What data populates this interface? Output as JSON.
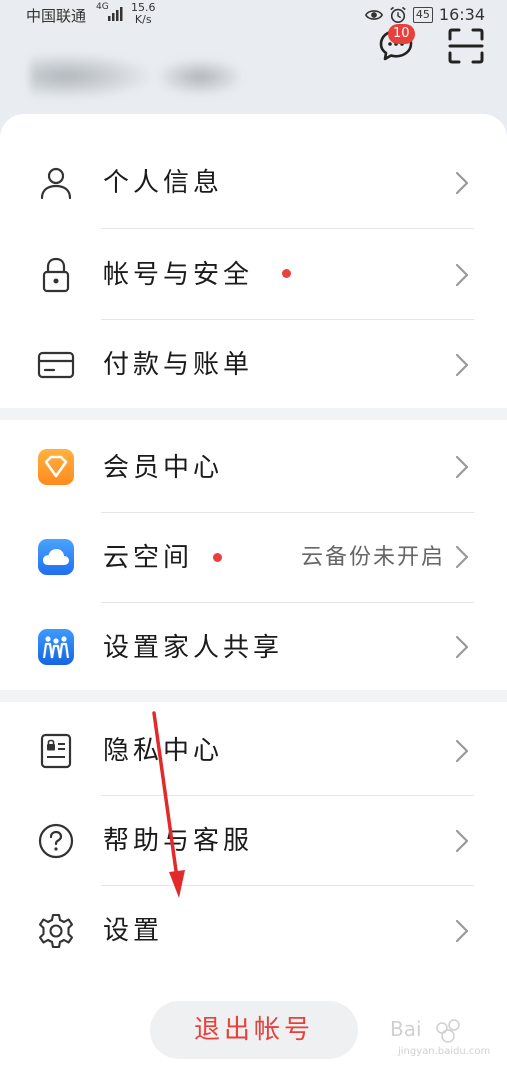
{
  "status_bar": {
    "carrier": "中国联通",
    "network": "4G",
    "speed_value": "15.6",
    "speed_unit": "K/s",
    "battery": "45",
    "time": "16:34"
  },
  "header": {
    "message_badge": "10"
  },
  "groups": [
    {
      "items": [
        {
          "label": "个人信息",
          "icon": "person-icon",
          "dot": false,
          "hint": ""
        },
        {
          "label": "帐号与安全",
          "icon": "lock-icon",
          "dot": true,
          "hint": ""
        },
        {
          "label": "付款与账单",
          "icon": "card-icon",
          "dot": false,
          "hint": ""
        }
      ]
    },
    {
      "items": [
        {
          "label": "会员中心",
          "icon": "member-diamond-icon",
          "dot": false,
          "hint": ""
        },
        {
          "label": "云空间",
          "icon": "cloud-icon",
          "dot": true,
          "hint": "云备份未开启"
        },
        {
          "label": "设置家人共享",
          "icon": "family-share-icon",
          "dot": false,
          "hint": ""
        }
      ]
    },
    {
      "items": [
        {
          "label": "隐私中心",
          "icon": "privacy-icon",
          "dot": false,
          "hint": ""
        },
        {
          "label": "帮助与客服",
          "icon": "help-icon",
          "dot": false,
          "hint": ""
        },
        {
          "label": "设置",
          "icon": "gear-icon",
          "dot": false,
          "hint": ""
        }
      ]
    }
  ],
  "logout_label": "退出帐号",
  "watermark": {
    "brand": "Bai",
    "sub": "jingyan.baidu.com"
  },
  "colors": {
    "accent_red": "#e8403a",
    "background": "#e9edf1",
    "card": "#ffffff"
  }
}
